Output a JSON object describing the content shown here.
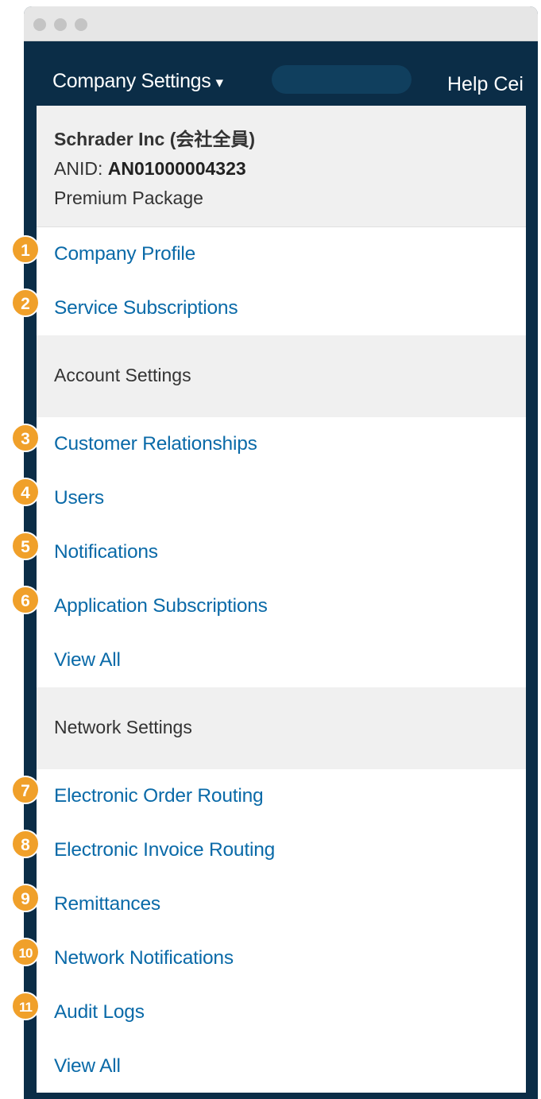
{
  "header": {
    "menu_title": "Company Settings",
    "menu_caret": "▾",
    "help_label": "Help Cei"
  },
  "company": {
    "name": "Schrader Inc (会社全員)",
    "anid_label": "ANID: ",
    "anid_value": "AN01000004323",
    "package": "Premium Package"
  },
  "top_items": [
    {
      "label": "Company Profile",
      "badge": "1"
    },
    {
      "label": "Service Subscriptions",
      "badge": "2"
    }
  ],
  "account_settings": {
    "heading": "Account Settings",
    "items": [
      {
        "label": "Customer Relationships",
        "badge": "3"
      },
      {
        "label": "Users",
        "badge": "4"
      },
      {
        "label": "Notifications",
        "badge": "5"
      },
      {
        "label": "Application Subscriptions",
        "badge": "6"
      }
    ],
    "view_all": "View All"
  },
  "network_settings": {
    "heading": "Network Settings",
    "items": [
      {
        "label": "Electronic Order Routing",
        "badge": "7"
      },
      {
        "label": "Electronic Invoice Routing",
        "badge": "8"
      },
      {
        "label": "Remittances",
        "badge": "9"
      },
      {
        "label": "Network Notifications",
        "badge": "10"
      },
      {
        "label": "Audit Logs",
        "badge": "11"
      }
    ],
    "view_all": "View All"
  },
  "colors": {
    "navbar": "#0b2d47",
    "link": "#0a6aa8",
    "badge": "#f0a02a",
    "section_bg": "#f0f0f0"
  }
}
